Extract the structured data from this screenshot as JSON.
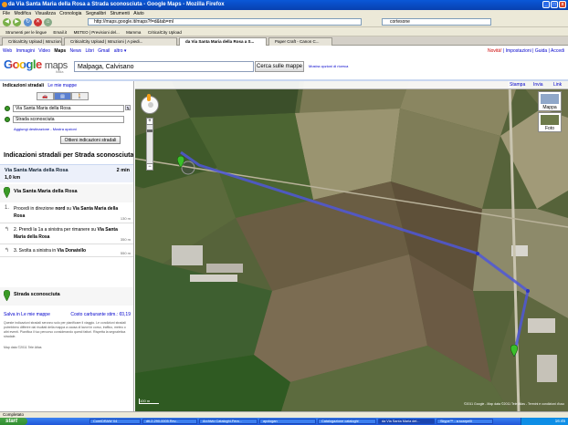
{
  "window": {
    "title": "da Via Santa Maria della Rosa a Strada sconosciuta - Google Maps - Mozilla Firefox",
    "minimize": "_",
    "maximize": "□",
    "close": "x"
  },
  "menu": [
    "File",
    "Modifica",
    "Visualizza",
    "Cronologia",
    "Segnalibri",
    "Strumenti",
    "Aiuto"
  ],
  "nav": {
    "url": "http://maps.google.it/maps?f=d&tab=ml",
    "search_value": "cortesone"
  },
  "bookmarks": [
    "Strumenti per le lingue",
    "Email.it",
    "METEO | Previsioni del...",
    "Mamma",
    "CriticalCity Upload"
  ],
  "tabs": [
    {
      "label": "CriticalCity Upload | Istruzioni"
    },
    {
      "label": "CriticalCity Upload | Istruzioni | A piedi..."
    },
    {
      "label": "da Via Santa Maria della Rosa a S...",
      "active": true
    },
    {
      "label": "Paper Craft - Canon C..."
    }
  ],
  "google": {
    "links": [
      "Web",
      "Immagini",
      "Video",
      "Maps",
      "News",
      "Libri",
      "Gmail",
      "altro ▾"
    ],
    "current_link": "Maps",
    "account": [
      "Novità!",
      "Impostazioni",
      "Guida",
      "Accedi"
    ],
    "logo_word": "Google",
    "logo_maps": "maps",
    "logo_country": "Italia",
    "query": "Malpaga, Calvisano",
    "search_button": "Cerca sulle mappe",
    "search_options": "Mostra opzioni di ricerca"
  },
  "panel": {
    "tab_directions": "Indicazioni stradali",
    "tab_mymaps": "Le mie mappe",
    "mode_icons": [
      "car-icon",
      "transit-icon",
      "walk-icon"
    ],
    "from": "Via Santa Maria della Rosa",
    "to": "Strada sconosciuta",
    "add_destination": "Aggiungi destinazione",
    "show_options": "Mostra opzioni",
    "get_directions_button": "Ottieni indicazioni stradali",
    "title": "Indicazioni stradali per Strada sconosciuta",
    "summary_from": "Via Santa Maria della Rosa",
    "summary_time": "2 min",
    "summary_distance": "1,0 km",
    "start_label": "Via Santa Maria della Rosa",
    "steps": [
      {
        "num": "1.",
        "pre": "Procedi in direzione ",
        "b1": "nord",
        "mid": " su ",
        "b2": "Via Santa Maria della Rosa",
        "dist": "130 m"
      },
      {
        "num": "2.",
        "pre": "Prendi la 1a a sinistra per rimanere su ",
        "b1": "Via Santa Maria della Rosa",
        "mid": "",
        "b2": "",
        "dist": "350 m"
      },
      {
        "num": "3.",
        "pre": "Svolta a sinistra in ",
        "b1": "Via Donatello",
        "mid": "",
        "b2": "",
        "dist": "550 m"
      }
    ],
    "end_label": "Strada sconosciuta",
    "save_link": "Salva in Le mie mappe",
    "cost_link": "Costo carburante stim.: €0,19",
    "disclaimer": "Queste indicazioni stradali servono solo per pianificare il viaggio. Le condizioni stradali potrebbero differire dai risultati della mappa a causa di lavori in corso, traffico, meteo o altri eventi. Pianifica il tuo percorso considerando questi fattori. Rispetta la segnaletica stradale.",
    "map_data": "Map data ©2011 Tele Atlas"
  },
  "map": {
    "tools": [
      "Stampa",
      "Invia",
      "Link"
    ],
    "type_buttons": [
      "Mappa",
      "Foto"
    ],
    "scale": "100 m",
    "copyright": "©2011 Google - Map data ©2011 Tele Atlas - Termini e condizioni d'uso",
    "route_color": "#4f57d8"
  },
  "status": "Completato",
  "taskbar": {
    "start": "start",
    "tasks": [
      "CorelDRAW X4",
      "dti-2-290-0005.Rev...",
      "Archivio Cataloghi-Fera...",
      "apologan",
      "Catalogazione cataloghi",
      "da Via Santa Maria del...",
      "Skype™ - a.scarpelli"
    ],
    "active_task": "da Via Santa Maria del...",
    "clock": "16:45"
  }
}
